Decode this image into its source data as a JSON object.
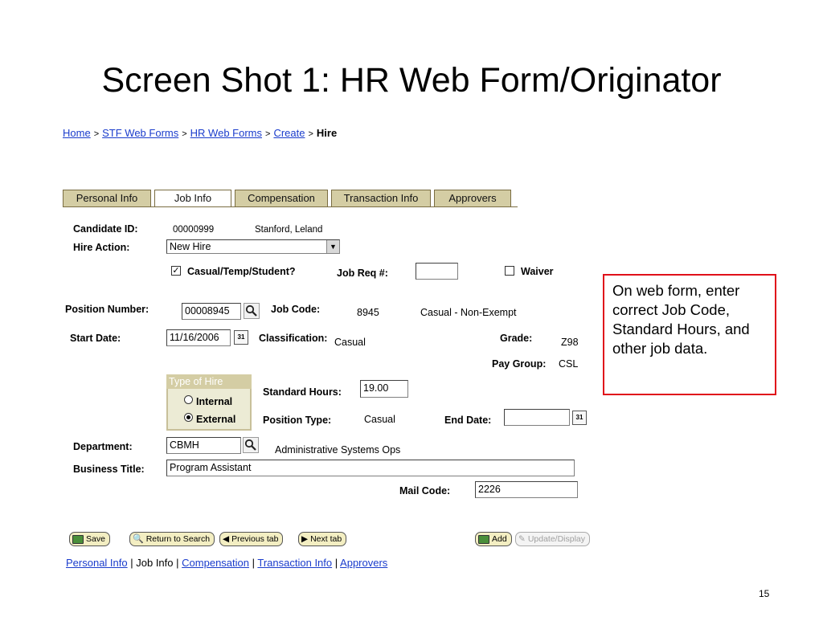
{
  "slide": {
    "title": "Screen Shot 1: HR Web Form/Originator",
    "page_number": "15"
  },
  "breadcrumb": {
    "items": [
      "Home",
      "STF Web Forms",
      "HR Web Forms",
      "Create"
    ],
    "separator": ">",
    "current": "Hire"
  },
  "tabs": [
    {
      "label": "Personal Info",
      "active": false
    },
    {
      "label": "Job Info",
      "active": true
    },
    {
      "label": "Compensation",
      "active": false
    },
    {
      "label": "Transaction Info",
      "active": false
    },
    {
      "label": "Approvers",
      "active": false
    }
  ],
  "form": {
    "candidate_id_label": "Candidate ID:",
    "candidate_id": "00000999",
    "candidate_name": "Stanford, Leland",
    "hire_action_label": "Hire Action:",
    "hire_action_value": "New Hire",
    "casual_label": "Casual/Temp/Student?",
    "casual_checked": true,
    "job_req_label": "Job Req #:",
    "job_req_value": "",
    "waiver_label": "Waiver",
    "waiver_checked": false,
    "position_number_label": "Position Number:",
    "position_number": "00008945",
    "job_code_label": "Job Code:",
    "job_code": "8945",
    "job_code_desc": "Casual - Non-Exempt",
    "start_date_label": "Start Date:",
    "start_date": "11/16/2006",
    "classification_label": "Classification:",
    "classification": "Casual",
    "grade_label": "Grade:",
    "grade": "Z98",
    "pay_group_label": "Pay Group:",
    "pay_group": "CSL",
    "type_of_hire_label": "Type of Hire",
    "internal_label": "Internal",
    "external_label": "External",
    "type_of_hire_selected": "External",
    "standard_hours_label": "Standard Hours:",
    "standard_hours": "19.00",
    "position_type_label": "Position Type:",
    "position_type": "Casual",
    "end_date_label": "End Date:",
    "end_date": "",
    "department_label": "Department:",
    "department": "CBMH",
    "department_desc": "Administrative Systems Ops",
    "business_title_label": "Business Title:",
    "business_title": "Program Assistant",
    "mail_code_label": "Mail Code:",
    "mail_code": "2226",
    "calendar_icon_text": "31"
  },
  "buttons": {
    "save": "Save",
    "return_to_search": "Return to Search",
    "previous_tab": "Previous tab",
    "next_tab": "Next tab",
    "add": "Add",
    "update_display": "Update/Display"
  },
  "bottom_links": {
    "items": [
      "Personal Info",
      "Job Info",
      "Compensation",
      "Transaction Info",
      "Approvers"
    ],
    "separator": "|"
  },
  "callout": {
    "text": "On web form, enter correct Job Code, Standard Hours, and other job data."
  },
  "colors": {
    "link": "#1a3ccc",
    "tab_bg": "#d4cda4",
    "callout_border": "#e0101a",
    "button_bg": "#f3eec2"
  }
}
